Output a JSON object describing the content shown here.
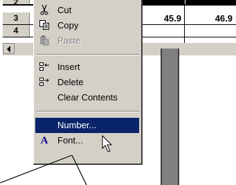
{
  "sheet": {
    "rows": [
      {
        "num": "2",
        "cells": [
          "",
          ""
        ]
      },
      {
        "num": "3",
        "cells": [
          "45.9",
          "46.9"
        ]
      },
      {
        "num": "4",
        "cells": [
          "",
          ""
        ]
      }
    ]
  },
  "context_menu": {
    "items": [
      {
        "label": "Cut",
        "icon": "scissors-icon",
        "disabled": false
      },
      {
        "label": "Copy",
        "icon": "copy-icon",
        "disabled": false
      },
      {
        "label": "Paste",
        "icon": "paste-icon",
        "disabled": true
      },
      {
        "label": "Insert",
        "icon": "insert-icon",
        "disabled": false
      },
      {
        "label": "Delete",
        "icon": "delete-icon",
        "disabled": false
      },
      {
        "label": "Clear Contents",
        "icon": "",
        "disabled": false
      },
      {
        "label": "Number...",
        "icon": "",
        "disabled": false,
        "highlighted": true
      },
      {
        "label": "Font...",
        "icon": "font-icon",
        "disabled": false
      }
    ]
  },
  "colors": {
    "menu_bg": "#d4d0c8",
    "highlight": "#0a246a"
  }
}
